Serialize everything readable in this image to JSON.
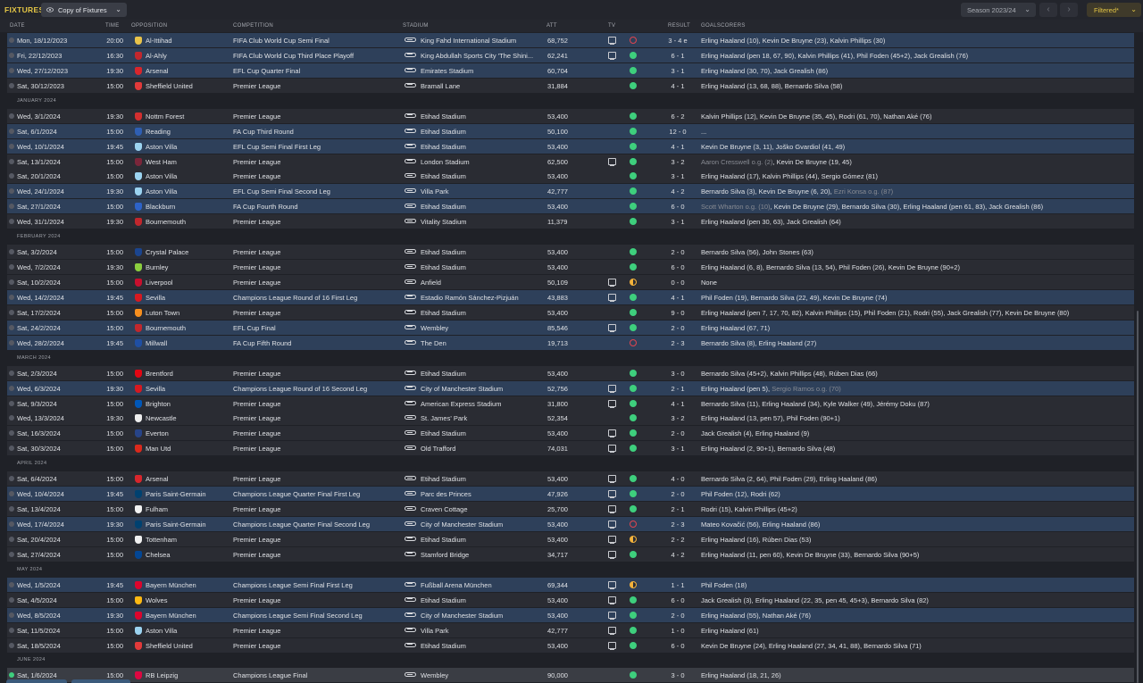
{
  "toolbar": {
    "title": "FIXTURES",
    "view_label": "Copy of Fixtures",
    "season_label": "Season 2023/24",
    "filter_label": "Filtered*"
  },
  "columns": {
    "date": "DATE",
    "time": "TIME",
    "opposition": "OPPOSITION",
    "competition": "COMPETITION",
    "stadium": "STADIUM",
    "att": "ATT",
    "tv": "TV",
    "result": "RESULT",
    "goalscorers": "GOALSCORERS"
  },
  "colors": {
    "accent": "#e3c545",
    "win": "#3ecf7d",
    "loss": "#e0454f",
    "draw": "#f3b23b",
    "selected_row": "#2e405a"
  },
  "rows": [
    {
      "kind": "match",
      "sel": true,
      "date": "Mon, 18/12/2023",
      "time": "20:00",
      "opp": "Al-Ittihad",
      "badge": "#e8c34a",
      "comp": "FIFA Club World Cup Semi Final",
      "stad": "King Fahd International Stadium",
      "att": "68,752",
      "tv": true,
      "out": "loss",
      "res": "3 - 4 e",
      "scorers": [
        [
          "Erling Haaland (10), Kevin De Bruyne (23), Kalvin Phillips (30)",
          false
        ]
      ]
    },
    {
      "kind": "match",
      "sel": true,
      "date": "Fri, 22/12/2023",
      "time": "16:30",
      "opp": "Al-Ahly",
      "badge": "#c2272d",
      "comp": "FIFA Club World Cup Third Place Playoff",
      "stad": "King Abdullah Sports City 'The Shini...",
      "att": "62,241",
      "tv": true,
      "out": "win",
      "res": "6 - 1",
      "scorers": [
        [
          "Erling Haaland (pen 18, 67, 90), Kalvin Phillips (41), Phil Foden (45+2), Jack Grealish (76)",
          false
        ]
      ]
    },
    {
      "kind": "match",
      "sel": true,
      "date": "Wed, 27/12/2023",
      "time": "19:30",
      "opp": "Arsenal",
      "badge": "#d8262c",
      "comp": "EFL Cup Quarter Final",
      "stad": "Emirates Stadium",
      "att": "60,704",
      "tv": false,
      "out": "win",
      "res": "3 - 1",
      "scorers": [
        [
          "Erling Haaland (30, 70), Jack Grealish (86)",
          false
        ]
      ]
    },
    {
      "kind": "match",
      "sel": false,
      "date": "Sat, 30/12/2023",
      "time": "15:00",
      "opp": "Sheffield United",
      "badge": "#e23a3a",
      "comp": "Premier League",
      "stad": "Bramall Lane",
      "att": "31,884",
      "tv": false,
      "out": "win",
      "res": "4 - 1",
      "scorers": [
        [
          "Erling Haaland (13, 68, 88), Bernardo Silva (58)",
          false
        ]
      ]
    },
    {
      "kind": "month",
      "label": "JANUARY 2024"
    },
    {
      "kind": "match",
      "sel": false,
      "date": "Wed, 3/1/2024",
      "time": "19:30",
      "opp": "Nottm Forest",
      "badge": "#d32f2f",
      "comp": "Premier League",
      "stad": "Etihad Stadium",
      "att": "53,400",
      "tv": false,
      "out": "win",
      "res": "6 - 2",
      "scorers": [
        [
          "Kalvin Phillips (12), Kevin De Bruyne (35, 45), Rodri (61, 70), Nathan Aké (76)",
          false
        ]
      ]
    },
    {
      "kind": "match",
      "sel": true,
      "date": "Sat, 6/1/2024",
      "time": "15:00",
      "opp": "Reading",
      "badge": "#2f5fb3",
      "comp": "FA Cup Third Round",
      "stad": "Etihad Stadium",
      "att": "50,100",
      "tv": false,
      "out": "win",
      "res": "12 - 0",
      "scorers": [
        [
          "...",
          false
        ]
      ]
    },
    {
      "kind": "match",
      "sel": true,
      "date": "Wed, 10/1/2024",
      "time": "19:45",
      "opp": "Aston Villa",
      "badge": "#9bd3f0",
      "comp": "EFL Cup Semi Final First Leg",
      "stad": "Etihad Stadium",
      "att": "53,400",
      "tv": false,
      "out": "win",
      "res": "4 - 1",
      "scorers": [
        [
          "Kevin De Bruyne (3, 11), Joško Gvardiol (41, 49)",
          false
        ]
      ]
    },
    {
      "kind": "match",
      "sel": false,
      "date": "Sat, 13/1/2024",
      "time": "15:00",
      "opp": "West Ham",
      "badge": "#7a263a",
      "comp": "Premier League",
      "stad": "London Stadium",
      "att": "62,500",
      "tv": true,
      "out": "win",
      "res": "3 - 2",
      "scorers": [
        [
          "Aaron Cresswell o.g. (2)",
          true
        ],
        [
          ", Kevin De Bruyne (19, 45)",
          false
        ]
      ]
    },
    {
      "kind": "match",
      "sel": false,
      "date": "Sat, 20/1/2024",
      "time": "15:00",
      "opp": "Aston Villa",
      "badge": "#9bd3f0",
      "comp": "Premier League",
      "stad": "Etihad Stadium",
      "att": "53,400",
      "tv": false,
      "out": "win",
      "res": "3 - 1",
      "scorers": [
        [
          "Erling Haaland (17), Kalvin Phillips (44), Sergio Gómez (81)",
          false
        ]
      ]
    },
    {
      "kind": "match",
      "sel": true,
      "date": "Wed, 24/1/2024",
      "time": "19:30",
      "opp": "Aston Villa",
      "badge": "#9bd3f0",
      "comp": "EFL Cup Semi Final Second Leg",
      "stad": "Villa Park",
      "att": "42,777",
      "tv": false,
      "out": "win",
      "res": "4 - 2",
      "scorers": [
        [
          "Bernardo Silva (3), Kevin De Bruyne (6, 20), ",
          false
        ],
        [
          "Ezri Konsa o.g. (87)",
          true
        ]
      ]
    },
    {
      "kind": "match",
      "sel": true,
      "date": "Sat, 27/1/2024",
      "time": "15:00",
      "opp": "Blackburn",
      "badge": "#2d63c8",
      "comp": "FA Cup Fourth Round",
      "stad": "Etihad Stadium",
      "att": "53,400",
      "tv": false,
      "out": "win",
      "res": "6 - 0",
      "scorers": [
        [
          "Scott Wharton o.g. (10)",
          true
        ],
        [
          ", Kevin De Bruyne (29), Bernardo Silva (30), Erling Haaland (pen 61, 83), Jack Grealish (86)",
          false
        ]
      ]
    },
    {
      "kind": "match",
      "sel": false,
      "date": "Wed, 31/1/2024",
      "time": "19:30",
      "opp": "Bournemouth",
      "badge": "#c1272d",
      "comp": "Premier League",
      "stad": "Vitality Stadium",
      "att": "11,379",
      "tv": false,
      "out": "win",
      "res": "3 - 1",
      "scorers": [
        [
          "Erling Haaland (pen 30, 63), Jack Grealish (64)",
          false
        ]
      ]
    },
    {
      "kind": "month",
      "label": "FEBRUARY 2024"
    },
    {
      "kind": "match",
      "sel": false,
      "date": "Sat, 3/2/2024",
      "time": "15:00",
      "opp": "Crystal Palace",
      "badge": "#1b458f",
      "comp": "Premier League",
      "stad": "Etihad Stadium",
      "att": "53,400",
      "tv": false,
      "out": "win",
      "res": "2 - 0",
      "scorers": [
        [
          "Bernardo Silva (56), John Stones (63)",
          false
        ]
      ]
    },
    {
      "kind": "match",
      "sel": false,
      "date": "Wed, 7/2/2024",
      "time": "19:30",
      "opp": "Burnley",
      "badge": "#8ccf3f",
      "comp": "Premier League",
      "stad": "Etihad Stadium",
      "att": "53,400",
      "tv": false,
      "out": "win",
      "res": "6 - 0",
      "scorers": [
        [
          "Erling Haaland (6, 8), Bernardo Silva (13, 54), Phil Foden (26), Kevin De Bruyne (90+2)",
          false
        ]
      ]
    },
    {
      "kind": "match",
      "sel": false,
      "date": "Sat, 10/2/2024",
      "time": "15:00",
      "opp": "Liverpool",
      "badge": "#c8102e",
      "comp": "Premier League",
      "stad": "Anfield",
      "att": "50,109",
      "tv": true,
      "out": "draw",
      "res": "0 - 0",
      "scorers": [
        [
          "None",
          false
        ]
      ]
    },
    {
      "kind": "match",
      "sel": true,
      "date": "Wed, 14/2/2024",
      "time": "19:45",
      "opp": "Sevilla",
      "badge": "#d71920",
      "comp": "Champions League Round of 16  First Leg",
      "stad": "Estadio Ramón Sánchez-Pizjuán",
      "att": "43,883",
      "tv": true,
      "out": "win",
      "res": "4 - 1",
      "scorers": [
        [
          "Phil Foden (19), Bernardo Silva (22, 49), Kevin De Bruyne (74)",
          false
        ]
      ]
    },
    {
      "kind": "match",
      "sel": false,
      "date": "Sat, 17/2/2024",
      "time": "15:00",
      "opp": "Luton Town",
      "badge": "#f78f1e",
      "comp": "Premier League",
      "stad": "Etihad Stadium",
      "att": "53,400",
      "tv": false,
      "out": "win",
      "res": "9 - 0",
      "scorers": [
        [
          "Erling Haaland (pen 7, 17, 70, 82), Kalvin Phillips (15), Phil Foden (21), Rodri (55), Jack Grealish (77), Kevin De Bruyne (80)",
          false
        ]
      ]
    },
    {
      "kind": "match",
      "sel": true,
      "date": "Sat, 24/2/2024",
      "time": "15:00",
      "opp": "Bournemouth",
      "badge": "#c1272d",
      "comp": "EFL Cup Final",
      "stad": "Wembley",
      "att": "85,546",
      "tv": true,
      "out": "win",
      "res": "2 - 0",
      "scorers": [
        [
          "Erling Haaland (67, 71)",
          false
        ]
      ]
    },
    {
      "kind": "match",
      "sel": true,
      "date": "Wed, 28/2/2024",
      "time": "19:45",
      "opp": "Millwall",
      "badge": "#1f4fa3",
      "comp": "FA Cup Fifth Round",
      "stad": "The Den",
      "att": "19,713",
      "tv": false,
      "out": "loss",
      "res": "2 - 3",
      "scorers": [
        [
          "Bernardo Silva (8), Erling Haaland (27)",
          false
        ]
      ]
    },
    {
      "kind": "month",
      "label": "MARCH 2024"
    },
    {
      "kind": "match",
      "sel": false,
      "date": "Sat, 2/3/2024",
      "time": "15:00",
      "opp": "Brentford",
      "badge": "#e30613",
      "comp": "Premier League",
      "stad": "Etihad Stadium",
      "att": "53,400",
      "tv": false,
      "out": "win",
      "res": "3 - 0",
      "scorers": [
        [
          "Bernardo Silva (45+2), Kalvin Phillips (48), Rúben Dias (66)",
          false
        ]
      ]
    },
    {
      "kind": "match",
      "sel": true,
      "date": "Wed, 6/3/2024",
      "time": "19:30",
      "opp": "Sevilla",
      "badge": "#d71920",
      "comp": "Champions League Round of 16  Second Leg",
      "stad": "City of Manchester Stadium",
      "att": "52,756",
      "tv": true,
      "out": "win",
      "res": "2 - 1",
      "scorers": [
        [
          "Erling Haaland (pen 5), ",
          false
        ],
        [
          "Sergio Ramos o.g. (70)",
          true
        ]
      ]
    },
    {
      "kind": "match",
      "sel": false,
      "date": "Sat, 9/3/2024",
      "time": "15:00",
      "opp": "Brighton",
      "badge": "#0057b8",
      "comp": "Premier League",
      "stad": "American Express Stadium",
      "att": "31,800",
      "tv": true,
      "out": "win",
      "res": "4 - 1",
      "scorers": [
        [
          "Bernardo Silva (11), Erling Haaland (34), Kyle Walker (49), Jérémy Doku (87)",
          false
        ]
      ]
    },
    {
      "kind": "match",
      "sel": false,
      "date": "Wed, 13/3/2024",
      "time": "19:30",
      "opp": "Newcastle",
      "badge": "#eeeeee",
      "comp": "Premier League",
      "stad": "St. James' Park",
      "att": "52,354",
      "tv": false,
      "out": "win",
      "res": "3 - 2",
      "scorers": [
        [
          "Erling Haaland (13, pen 57), Phil Foden (90+1)",
          false
        ]
      ]
    },
    {
      "kind": "match",
      "sel": false,
      "date": "Sat, 16/3/2024",
      "time": "15:00",
      "opp": "Everton",
      "badge": "#274488",
      "comp": "Premier League",
      "stad": "Etihad Stadium",
      "att": "53,400",
      "tv": true,
      "out": "win",
      "res": "2 - 0",
      "scorers": [
        [
          "Jack Grealish (4), Erling Haaland (9)",
          false
        ]
      ]
    },
    {
      "kind": "match",
      "sel": false,
      "date": "Sat, 30/3/2024",
      "time": "15:00",
      "opp": "Man Utd",
      "badge": "#da291c",
      "comp": "Premier League",
      "stad": "Old Trafford",
      "att": "74,031",
      "tv": true,
      "out": "win",
      "res": "3 - 1",
      "scorers": [
        [
          "Erling Haaland (2, 90+1), Bernardo Silva (48)",
          false
        ]
      ]
    },
    {
      "kind": "month",
      "label": "APRIL 2024"
    },
    {
      "kind": "match",
      "sel": false,
      "date": "Sat, 6/4/2024",
      "time": "15:00",
      "opp": "Arsenal",
      "badge": "#d8262c",
      "comp": "Premier League",
      "stad": "Etihad Stadium",
      "att": "53,400",
      "tv": true,
      "out": "win",
      "res": "4 - 0",
      "scorers": [
        [
          "Bernardo Silva (2, 64), Phil Foden (29), Erling Haaland (86)",
          false
        ]
      ]
    },
    {
      "kind": "match",
      "sel": true,
      "date": "Wed, 10/4/2024",
      "time": "19:45",
      "opp": "Paris Saint-Germain",
      "badge": "#004170",
      "comp": "Champions League Quarter Final First Leg",
      "stad": "Parc des Princes",
      "att": "47,926",
      "tv": true,
      "out": "win",
      "res": "2 - 0",
      "scorers": [
        [
          "Phil Foden (12), Rodri (62)",
          false
        ]
      ]
    },
    {
      "kind": "match",
      "sel": false,
      "date": "Sat, 13/4/2024",
      "time": "15:00",
      "opp": "Fulham",
      "badge": "#f2f2f2",
      "comp": "Premier League",
      "stad": "Craven Cottage",
      "att": "25,700",
      "tv": true,
      "out": "win",
      "res": "2 - 1",
      "scorers": [
        [
          "Rodri (15), Kalvin Phillips (45+2)",
          false
        ]
      ]
    },
    {
      "kind": "match",
      "sel": true,
      "date": "Wed, 17/4/2024",
      "time": "19:30",
      "opp": "Paris Saint-Germain",
      "badge": "#004170",
      "comp": "Champions League Quarter Final Second Leg",
      "stad": "City of Manchester Stadium",
      "att": "53,400",
      "tv": true,
      "out": "loss",
      "res": "2 - 3",
      "scorers": [
        [
          "Mateo Kovačić (56), Erling Haaland (86)",
          false
        ]
      ]
    },
    {
      "kind": "match",
      "sel": false,
      "date": "Sat, 20/4/2024",
      "time": "15:00",
      "opp": "Tottenham",
      "badge": "#f0f0f0",
      "comp": "Premier League",
      "stad": "Etihad Stadium",
      "att": "53,400",
      "tv": true,
      "out": "draw",
      "res": "2 - 2",
      "scorers": [
        [
          "Erling Haaland (16), Rúben Dias (53)",
          false
        ]
      ]
    },
    {
      "kind": "match",
      "sel": false,
      "date": "Sat, 27/4/2024",
      "time": "15:00",
      "opp": "Chelsea",
      "badge": "#034694",
      "comp": "Premier League",
      "stad": "Stamford Bridge",
      "att": "34,717",
      "tv": true,
      "out": "win",
      "res": "4 - 2",
      "scorers": [
        [
          "Erling Haaland (11, pen 60), Kevin De Bruyne (33), Bernardo Silva (90+5)",
          false
        ]
      ]
    },
    {
      "kind": "month",
      "label": "MAY 2024"
    },
    {
      "kind": "match",
      "sel": true,
      "date": "Wed, 1/5/2024",
      "time": "19:45",
      "opp": "Bayern München",
      "badge": "#dc052d",
      "comp": "Champions League Semi Final First Leg",
      "stad": "Fußball Arena München",
      "att": "69,344",
      "tv": true,
      "out": "draw",
      "res": "1 - 1",
      "scorers": [
        [
          "Phil Foden (18)",
          false
        ]
      ]
    },
    {
      "kind": "match",
      "sel": false,
      "date": "Sat, 4/5/2024",
      "time": "15:00",
      "opp": "Wolves",
      "badge": "#fdb913",
      "comp": "Premier League",
      "stad": "Etihad Stadium",
      "att": "53,400",
      "tv": true,
      "out": "win",
      "res": "6 - 0",
      "scorers": [
        [
          "Jack Grealish (3), Erling Haaland (22, 35, pen 45, 45+3), Bernardo Silva (82)",
          false
        ]
      ]
    },
    {
      "kind": "match",
      "sel": true,
      "date": "Wed, 8/5/2024",
      "time": "19:30",
      "opp": "Bayern München",
      "badge": "#dc052d",
      "comp": "Champions League Semi Final Second Leg",
      "stad": "City of Manchester Stadium",
      "att": "53,400",
      "tv": true,
      "out": "win",
      "res": "2 - 0",
      "scorers": [
        [
          "Erling Haaland (55), Nathan Aké (76)",
          false
        ]
      ]
    },
    {
      "kind": "match",
      "sel": false,
      "date": "Sat, 11/5/2024",
      "time": "15:00",
      "opp": "Aston Villa",
      "badge": "#9bd3f0",
      "comp": "Premier League",
      "stad": "Villa Park",
      "att": "42,777",
      "tv": true,
      "out": "win",
      "res": "1 - 0",
      "scorers": [
        [
          "Erling Haaland (61)",
          false
        ]
      ]
    },
    {
      "kind": "match",
      "sel": false,
      "date": "Sat, 18/5/2024",
      "time": "15:00",
      "opp": "Sheffield United",
      "badge": "#e23a3a",
      "comp": "Premier League",
      "stad": "Etihad Stadium",
      "att": "53,400",
      "tv": true,
      "out": "win",
      "res": "6 - 0",
      "scorers": [
        [
          "Kevin De Bruyne (24), Erling Haaland (27, 34, 41, 88), Bernardo Silva (71)",
          false
        ]
      ]
    },
    {
      "kind": "month",
      "label": "JUNE 2024"
    },
    {
      "kind": "match",
      "sel": false,
      "last": true,
      "date": "Sat, 1/6/2024",
      "time": "15:00",
      "opp": "RB Leipzig",
      "badge": "#dd0741",
      "comp": "Champions League Final",
      "stad": "Wembley",
      "att": "90,000",
      "tv": false,
      "out": "win",
      "res": "3 - 0",
      "scorers": [
        [
          "Erling Haaland (18, 21, 26)",
          false
        ]
      ]
    }
  ]
}
